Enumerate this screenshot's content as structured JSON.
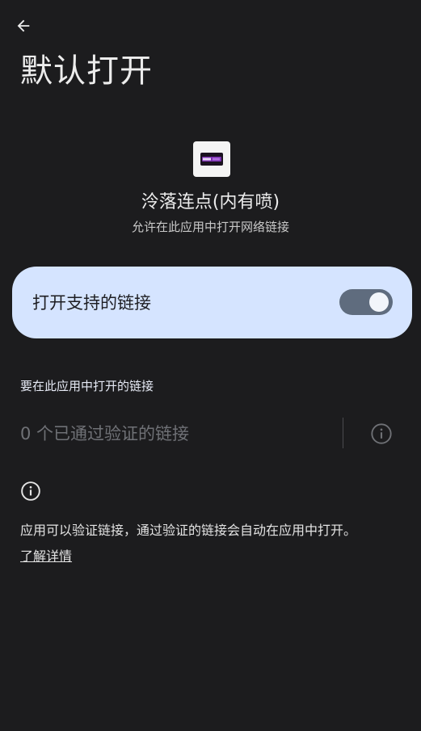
{
  "header": {
    "back_icon": "arrow-back-icon",
    "title": "默认打开"
  },
  "app": {
    "icon": "app-icon",
    "name": "泠落连点(内有喷)",
    "description": "允许在此应用中打开网络链接"
  },
  "toggle": {
    "label": "打开支持的链接",
    "enabled": true,
    "card_color": "#d5e4ff",
    "track_color": "#5f6c7e"
  },
  "links": {
    "section_title": "要在此应用中打开的链接",
    "verified_count_text": "0 个已通过验证的链接",
    "info_icon": "info-icon"
  },
  "footer": {
    "info_icon": "info-icon",
    "text": "应用可以验证链接，通过验证的链接会自动在应用中打开。",
    "learn_more": "了解详情"
  },
  "colors": {
    "background": "#1c1c1e",
    "text_primary": "#ececec",
    "text_muted": "#6f7176"
  }
}
